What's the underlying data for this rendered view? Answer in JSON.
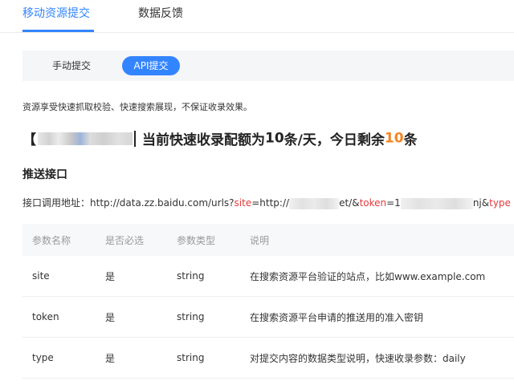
{
  "tabs": {
    "active": "移动资源提交",
    "other": "数据反馈"
  },
  "mode": {
    "manual": "手动提交",
    "api": "API提交"
  },
  "notice": "资源享受快速抓取校验、快速搜索展现，不保证收录效果。",
  "quota": {
    "bracket_open": "【",
    "text_before": "当前快速收录配额为",
    "daily_quota": "10",
    "text_middle": "条/天，今日剩余",
    "remaining": "10",
    "text_after": "条"
  },
  "section_title": "推送接口",
  "api_url": {
    "label": "接口调用地址：",
    "base": "http://data.zz.baidu.com/urls?",
    "site_key": "site",
    "site_prefix": "=http://",
    "site_suffix": "et/&",
    "token_key": "token",
    "token_prefix": "=1",
    "token_suffix": "nj&",
    "type_key": "type"
  },
  "table": {
    "headers": [
      "参数名称",
      "是否必选",
      "参数类型",
      "说明"
    ],
    "rows": [
      [
        "site",
        "是",
        "string",
        "在搜索资源平台验证的站点，比如www.example.com"
      ],
      [
        "token",
        "是",
        "string",
        "在搜索资源平台申请的推送用的准入密钥"
      ],
      [
        "type",
        "是",
        "string",
        "对提交内容的数据类型说明，快速收录参数：daily"
      ]
    ]
  },
  "colors": {
    "accent": "#3385ff",
    "highlight": "#f5841f",
    "param_key": "#e4393c"
  }
}
